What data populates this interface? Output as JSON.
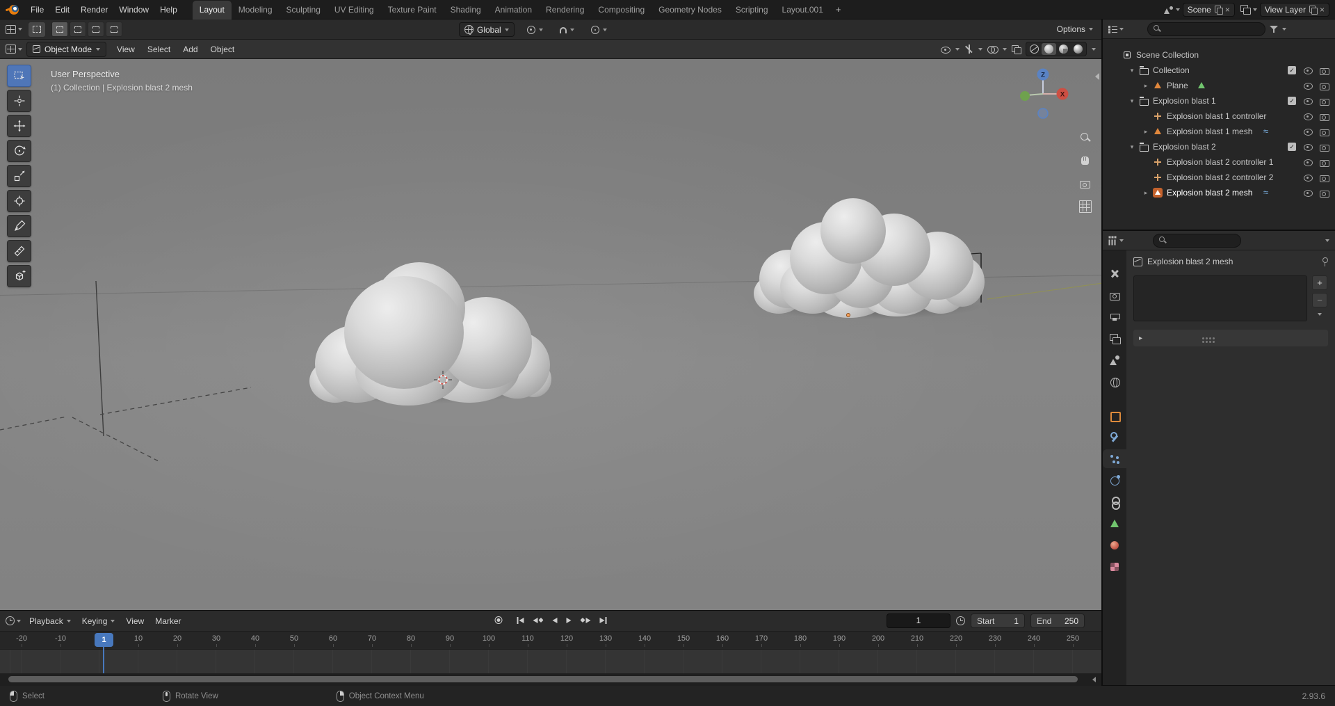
{
  "topbar": {
    "menus": [
      {
        "label": "File"
      },
      {
        "label": "Edit"
      },
      {
        "label": "Render"
      },
      {
        "label": "Window"
      },
      {
        "label": "Help"
      }
    ],
    "workspaces": [
      {
        "label": "Layout",
        "state": "active"
      },
      {
        "label": "Modeling",
        "state": ""
      },
      {
        "label": "Sculpting",
        "state": ""
      },
      {
        "label": "UV Editing",
        "state": ""
      },
      {
        "label": "Texture Paint",
        "state": ""
      },
      {
        "label": "Shading",
        "state": ""
      },
      {
        "label": "Animation",
        "state": ""
      },
      {
        "label": "Rendering",
        "state": ""
      },
      {
        "label": "Compositing",
        "state": ""
      },
      {
        "label": "Geometry Nodes",
        "state": ""
      },
      {
        "label": "Scripting",
        "state": ""
      },
      {
        "label": "Layout.001",
        "state": ""
      }
    ],
    "add_workspace_label": "+",
    "scene_selector": {
      "value": "Scene",
      "unlink_label": "×"
    },
    "view_layer_selector": {
      "value": "View Layer",
      "unlink_label": "×"
    }
  },
  "tool_settings": {
    "orientation": {
      "value": "Global"
    },
    "options_label": "Options"
  },
  "viewport_header": {
    "mode": {
      "value": "Object Mode"
    },
    "menus": [
      {
        "label": "View"
      },
      {
        "label": "Select"
      },
      {
        "label": "Add"
      },
      {
        "label": "Object"
      }
    ]
  },
  "viewport": {
    "overlay": {
      "line1": "User Perspective",
      "line2": "(1) Collection | Explosion blast 2 mesh"
    },
    "gizmo": {
      "z_label": "Z",
      "x_label": "X"
    }
  },
  "outliner": {
    "search_value": "",
    "search_placeholder": "",
    "rows": [
      {
        "label": "Scene Collection",
        "depth": "d0",
        "exp": "none",
        "icon": "scenecol",
        "extra": "",
        "checkbox": false,
        "eye": false,
        "cam": false,
        "state": ""
      },
      {
        "label": "Collection",
        "depth": "d1",
        "exp": "open",
        "icon": "collection",
        "extra": "",
        "checkbox": true,
        "eye": true,
        "cam": true,
        "state": ""
      },
      {
        "label": "Plane",
        "depth": "d2",
        "exp": "closed",
        "icon": "object",
        "extra": "meshdata",
        "checkbox": false,
        "eye": true,
        "cam": true,
        "state": ""
      },
      {
        "label": "Explosion blast 1",
        "depth": "d1",
        "exp": "open",
        "icon": "collection",
        "extra": "",
        "checkbox": true,
        "eye": true,
        "cam": true,
        "state": ""
      },
      {
        "label": "Explosion blast 1 controller",
        "depth": "d2",
        "exp": "none",
        "icon": "empty",
        "extra": "",
        "checkbox": false,
        "eye": true,
        "cam": true,
        "state": ""
      },
      {
        "label": "Explosion blast 1 mesh",
        "depth": "d2",
        "exp": "closed",
        "icon": "object",
        "extra": "mod",
        "checkbox": false,
        "eye": true,
        "cam": true,
        "state": ""
      },
      {
        "label": "Explosion blast 2",
        "depth": "d1",
        "exp": "open",
        "icon": "collection",
        "extra": "",
        "checkbox": true,
        "eye": true,
        "cam": true,
        "state": ""
      },
      {
        "label": "Explosion blast 2 controller 1",
        "depth": "d2",
        "exp": "none",
        "icon": "empty",
        "extra": "",
        "checkbox": false,
        "eye": true,
        "cam": true,
        "state": ""
      },
      {
        "label": "Explosion blast 2 controller 2",
        "depth": "d2",
        "exp": "none",
        "icon": "empty",
        "extra": "",
        "checkbox": false,
        "eye": true,
        "cam": true,
        "state": ""
      },
      {
        "label": "Explosion blast 2 mesh",
        "depth": "d2",
        "exp": "closed",
        "icon": "object-active",
        "extra": "mod",
        "checkbox": false,
        "eye": true,
        "cam": true,
        "state": "active"
      }
    ]
  },
  "properties": {
    "search_value": "",
    "search_placeholder": "",
    "breadcrumb": "Explosion blast 2 mesh",
    "add_button": "+",
    "remove_button": "−",
    "tabs": [
      {
        "name": "tab-tool",
        "icon": "ic-tool",
        "state": ""
      },
      {
        "name": "tab-render",
        "icon": "ic-render",
        "state": ""
      },
      {
        "name": "tab-output",
        "icon": "ic-output",
        "state": ""
      },
      {
        "name": "tab-view-layer",
        "icon": "ic-viewlayer",
        "state": ""
      },
      {
        "name": "tab-scene",
        "icon": "ic-scene",
        "state": ""
      },
      {
        "name": "tab-world",
        "icon": "ic-world",
        "state": ""
      },
      {
        "name": "tab-object",
        "icon": "ic-object",
        "state": "gap"
      },
      {
        "name": "tab-modifiers",
        "icon": "ic-modifiers",
        "state": ""
      },
      {
        "name": "tab-particles",
        "icon": "ic-particles",
        "state": "active"
      },
      {
        "name": "tab-physics",
        "icon": "ic-physics",
        "state": ""
      },
      {
        "name": "tab-constraints",
        "icon": "ic-constraints",
        "state": ""
      },
      {
        "name": "tab-object-data",
        "icon": "ic-data",
        "state": ""
      },
      {
        "name": "tab-material",
        "icon": "ic-material",
        "state": ""
      },
      {
        "name": "tab-texture",
        "icon": "ic-texture",
        "state": ""
      }
    ]
  },
  "timeline": {
    "menus": [
      {
        "label": "Playback",
        "caret": true
      },
      {
        "label": "Keying",
        "caret": true
      },
      {
        "label": "View",
        "caret": false
      },
      {
        "label": "Marker",
        "caret": false
      }
    ],
    "current_frame": "1",
    "playhead_frame": "1",
    "start_label": "Start",
    "start_value": "1",
    "end_label": "End",
    "end_value": "250",
    "ticks": [
      {
        "label": "-20"
      },
      {
        "label": "-10"
      },
      {
        "label": ""
      },
      {
        "label": "10"
      },
      {
        "label": "20"
      },
      {
        "label": "30"
      },
      {
        "label": "40"
      },
      {
        "label": "50"
      },
      {
        "label": "60"
      },
      {
        "label": "70"
      },
      {
        "label": "80"
      },
      {
        "label": "90"
      },
      {
        "label": "100"
      },
      {
        "label": "110"
      },
      {
        "label": "120"
      },
      {
        "label": "130"
      },
      {
        "label": "140"
      },
      {
        "label": "150"
      },
      {
        "label": "160"
      },
      {
        "label": "170"
      },
      {
        "label": "180"
      },
      {
        "label": "190"
      },
      {
        "label": "200"
      },
      {
        "label": "210"
      },
      {
        "label": "220"
      },
      {
        "label": "230"
      },
      {
        "label": "240"
      },
      {
        "label": "250"
      }
    ]
  },
  "statusbar": {
    "hints": [
      {
        "label": "Select",
        "btn": "left"
      },
      {
        "label": "Rotate View",
        "btn": "middle"
      },
      {
        "label": "Object Context Menu",
        "btn": "right"
      }
    ],
    "version": "2.93.6"
  },
  "colors": {
    "accent_blue": "#4772b3",
    "object_orange": "#e0873c",
    "mesh_data_green": "#71c56e",
    "modifier_blue": "#79aede",
    "axis_x_red": "#cc4f43",
    "axis_y_green": "#6fa14e",
    "axis_z_blue": "#5a83c4"
  }
}
